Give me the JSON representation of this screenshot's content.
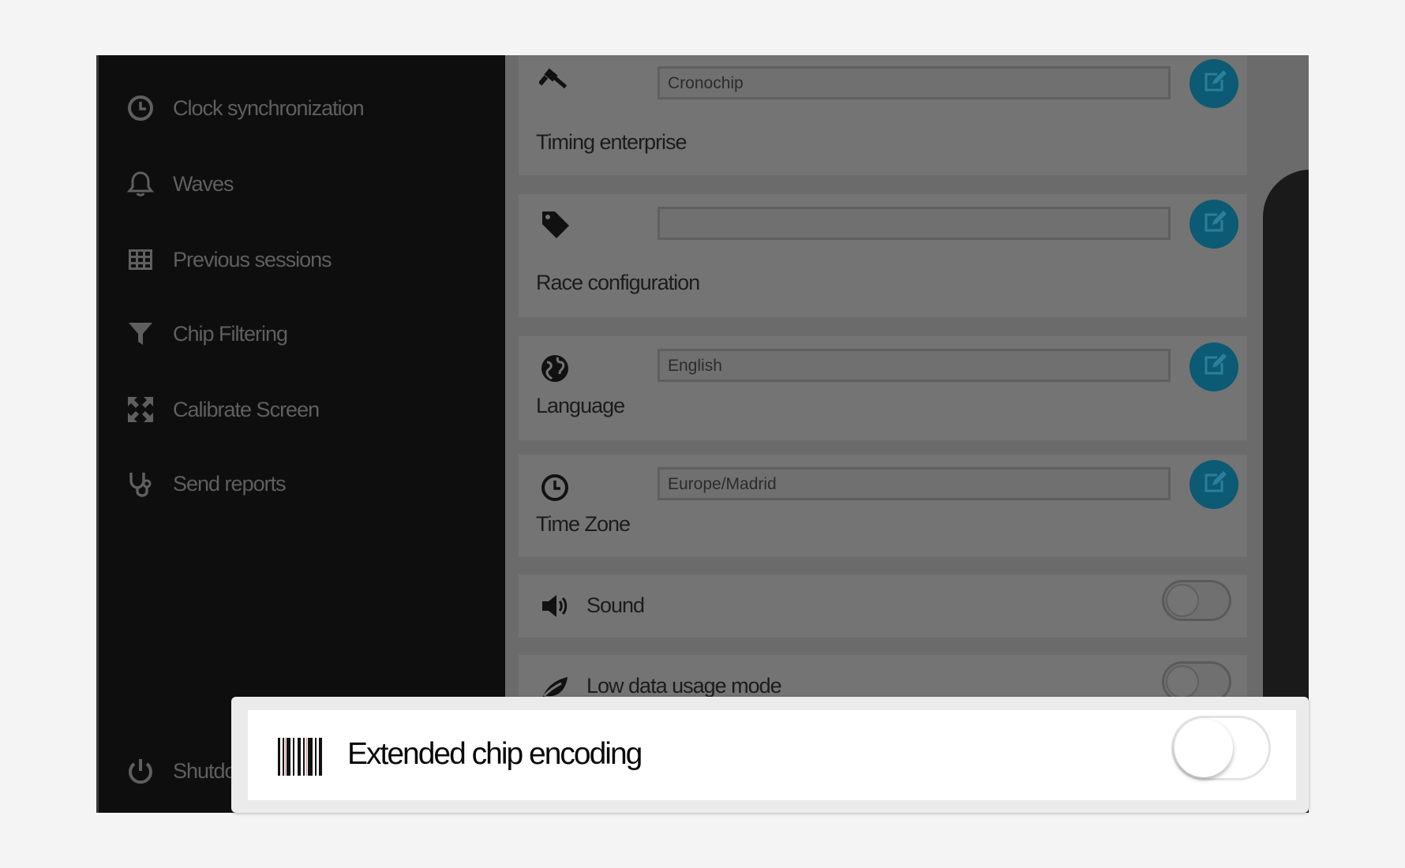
{
  "sidebar": {
    "items": [
      {
        "label": "Clock synchronization",
        "icon": "clock-icon"
      },
      {
        "label": "Waves",
        "icon": "bell-icon"
      },
      {
        "label": "Previous sessions",
        "icon": "table-icon"
      },
      {
        "label": "Chip Filtering",
        "icon": "filter-icon"
      },
      {
        "label": "Calibrate Screen",
        "icon": "expand-arrows-icon"
      },
      {
        "label": "Send reports",
        "icon": "stethoscope-icon"
      }
    ],
    "shutdown_label": "Shutdo"
  },
  "settings": {
    "timing_enterprise": {
      "label": "Timing enterprise",
      "value": "Cronochip",
      "icon": "gavel-icon"
    },
    "race_configuration": {
      "label": "Race configuration",
      "value": "",
      "icon": "tag-icon"
    },
    "language": {
      "label": "Language",
      "value": "English",
      "icon": "globe-icon"
    },
    "time_zone": {
      "label": "Time Zone",
      "value": "Europe/Madrid",
      "icon": "clock-icon"
    },
    "sound": {
      "label": "Sound",
      "enabled": false,
      "icon": "speaker-icon"
    },
    "low_data": {
      "label": "Low data usage mode",
      "enabled": false,
      "icon": "leaf-icon"
    }
  },
  "popup": {
    "label": "Extended chip encoding",
    "enabled": false,
    "icon": "barcode-icon"
  },
  "colors": {
    "edit_button": "#0c5a73",
    "sidebar_bg": "#0e0e0e",
    "overlay_gray": "#6b6b6b"
  }
}
